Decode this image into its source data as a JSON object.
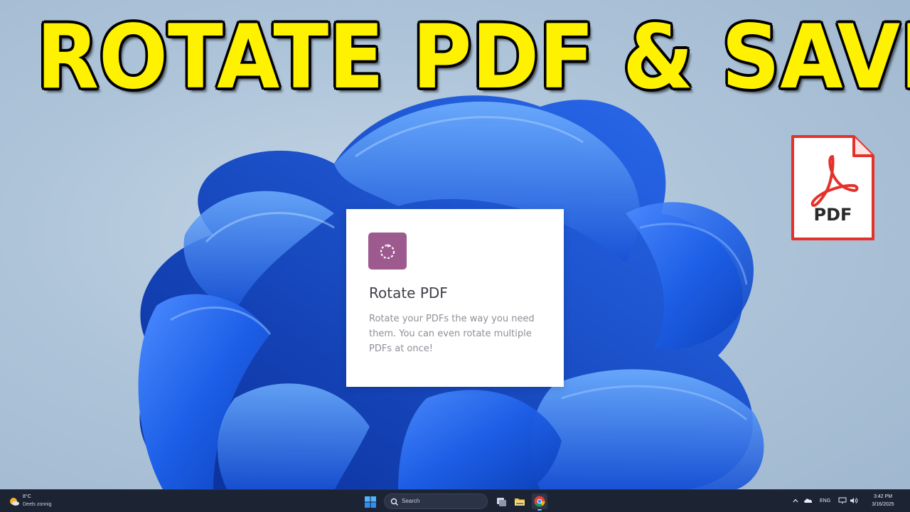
{
  "headline": "ROTATE PDF & SAVE",
  "card": {
    "title": "Rotate PDF",
    "description": "Rotate your PDFs the way you need them. You can even rotate multiple PDFs at once!",
    "icon": "rotate-icon",
    "icon_color": "#9c5a8f"
  },
  "pdf_file_icon": {
    "label": "PDF",
    "icon": "acrobat-icon",
    "border_color": "#e4322b"
  },
  "headline_color": "#fff200",
  "taskbar": {
    "weather": {
      "temp": "8°C",
      "condition": "Deels zonnig",
      "icon": "partly-sunny-icon"
    },
    "search_placeholder": "Search",
    "apps": [
      {
        "name": "task-view-icon",
        "active": false
      },
      {
        "name": "file-explorer-icon",
        "active": false
      },
      {
        "name": "chrome-icon",
        "active": true
      }
    ],
    "tray": {
      "language": "ENG",
      "time": "3:42 PM",
      "date": "3/16/2025"
    }
  }
}
